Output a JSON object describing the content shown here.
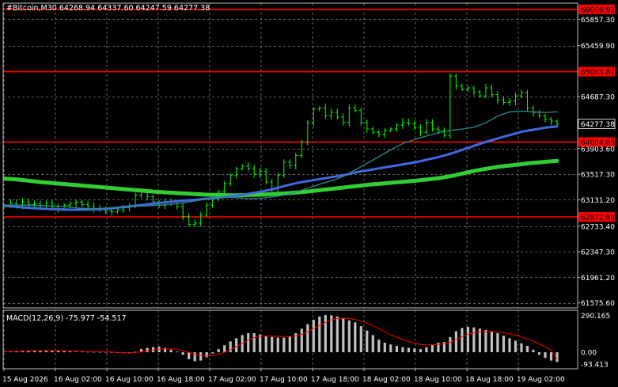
{
  "header": {
    "symbol_info": "#Bitcoin,M30  64268.94 64337.60 64247.59 64277.38"
  },
  "colors": {
    "background": "#000000",
    "grid": "#7f7f7f",
    "candle": "#00ff00",
    "ma_fast": "#2e8b8b",
    "ma_mid": "#4169e1",
    "ma_slow": "#32cd32",
    "level_line": "#ff0000",
    "macd_hist": "#c0c0c0",
    "macd_signal": "#ff0000"
  },
  "price_axis": {
    "ticks": [
      "65857.30",
      "65459.90",
      "64687.30",
      "63903.60",
      "63517.30",
      "63131.20",
      "62733.40",
      "62347.30",
      "61961.20",
      "61575.60"
    ],
    "current_price": "64277.38",
    "levels": [
      "66006.92",
      "65065.82",
      "64004.06",
      "62872.98"
    ]
  },
  "time_axis": {
    "labels": [
      "15 Aug 2026",
      "16 Aug 02:00",
      "16 Aug 10:00",
      "16 Aug 18:00",
      "17 Aug 02:00",
      "17 Aug 10:00",
      "17 Aug 18:00",
      "18 Aug 02:00",
      "18 Aug 10:00",
      "18 Aug 18:00",
      "19 Aug 02:00"
    ]
  },
  "macd": {
    "label": "MACD(12,26,9) -75.977 -54.517",
    "ticks": [
      "290.165",
      "0.00",
      "-93.413"
    ]
  },
  "chart_data": {
    "type": "line",
    "title": "#Bitcoin,M30",
    "ylim": [
      61500,
      66100
    ],
    "x_range": [
      "15 Aug 2026 00:00",
      "19 Aug 2026 07:30"
    ],
    "horizontal_levels": [
      66006.92,
      65065.82,
      64004.06,
      62872.98
    ],
    "series": [
      {
        "style": "candles",
        "values": [
          63040,
          63080,
          63050,
          63100,
          63060,
          63070,
          63040,
          63080,
          63030,
          63000,
          63050,
          63080,
          63100,
          63060,
          63030,
          63000,
          62980,
          62960,
          62950,
          62980,
          63010,
          63040,
          63200,
          63260,
          63180,
          63100,
          63050,
          63090,
          63070,
          63030,
          62880,
          62760,
          62780,
          62900,
          63050,
          63160,
          63250,
          63380,
          63500,
          63600,
          63640,
          63600,
          63520,
          63560,
          63400,
          63300,
          63500,
          63700,
          63650,
          63800,
          64000,
          64300,
          64500,
          64520,
          64400,
          64450,
          64380,
          64300,
          64520,
          64480,
          64300,
          64200,
          64150,
          64120,
          64180,
          64200,
          64260,
          64300,
          64280,
          64220,
          64150,
          64300,
          64200,
          64180,
          64100,
          65000,
          64850,
          64800,
          64820,
          64760,
          64700,
          64820,
          64720,
          64640,
          64600,
          64620,
          64700,
          64750,
          64520,
          64450,
          64400,
          64350,
          64320,
          64277
        ]
      },
      {
        "style": "line",
        "values": [
          63050,
          63055,
          63050,
          63045,
          63040,
          63030,
          63010,
          63000,
          63000,
          63010,
          63020,
          63030,
          63040,
          63050,
          63060,
          63080,
          63110,
          63140,
          63160,
          63170,
          63160,
          63150,
          63160,
          63180,
          63210,
          63260,
          63320,
          63380,
          63430,
          63500,
          63600,
          63700,
          63800,
          63900,
          63990,
          64050,
          64100,
          64150,
          64180,
          64200,
          64230,
          64300,
          64400,
          64460,
          64470,
          64460,
          64450,
          64460
        ]
      },
      {
        "style": "line",
        "values": [
          63040,
          63025,
          63010,
          63000,
          62990,
          62985,
          62980,
          62985,
          62990,
          63000,
          63020,
          63040,
          63060,
          63080,
          63100,
          63115,
          63130,
          63145,
          63160,
          63180,
          63200,
          63230,
          63260,
          63300,
          63350,
          63390,
          63420,
          63450,
          63480,
          63510,
          63550,
          63580,
          63610,
          63640,
          63670,
          63700,
          63740,
          63780,
          63830,
          63890,
          63950,
          64010,
          64060,
          64110,
          64160,
          64190,
          64220,
          64240
        ]
      },
      {
        "style": "line",
        "values": [
          63450,
          63440,
          63420,
          63400,
          63385,
          63370,
          63355,
          63340,
          63325,
          63310,
          63295,
          63280,
          63265,
          63250,
          63240,
          63230,
          63220,
          63210,
          63205,
          63200,
          63200,
          63205,
          63210,
          63220,
          63230,
          63245,
          63260,
          63280,
          63300,
          63320,
          63340,
          63360,
          63375,
          63390,
          63405,
          63420,
          63440,
          63460,
          63490,
          63530,
          63570,
          63600,
          63630,
          63650,
          63670,
          63690,
          63705,
          63720
        ]
      }
    ],
    "macd": {
      "ylim": [
        -130,
        330
      ],
      "histogram": [
        5,
        8,
        10,
        12,
        14,
        15,
        15,
        14,
        12,
        10,
        8,
        6,
        4,
        3,
        2,
        1,
        0,
        -2,
        -4,
        -5,
        -6,
        -8,
        5,
        25,
        35,
        40,
        45,
        35,
        20,
        5,
        -20,
        -55,
        -70,
        -65,
        -40,
        -10,
        25,
        55,
        85,
        110,
        135,
        150,
        150,
        140,
        130,
        120,
        115,
        115,
        125,
        150,
        185,
        220,
        255,
        280,
        292,
        290,
        280,
        265,
        250,
        235,
        205,
        170,
        135,
        100,
        75,
        60,
        50,
        40,
        35,
        30,
        25,
        40,
        60,
        75,
        80,
        120,
        165,
        190,
        200,
        195,
        185,
        175,
        165,
        150,
        130,
        110,
        90,
        70,
        50,
        20,
        -20,
        -45,
        -65,
        -76
      ],
      "signal": [
        5,
        6,
        7,
        8,
        10,
        11,
        12,
        13,
        13,
        12,
        11,
        10,
        9,
        8,
        6,
        5,
        4,
        3,
        1,
        -1,
        -3,
        -4,
        -2,
        4,
        10,
        18,
        25,
        28,
        27,
        23,
        14,
        0,
        -15,
        -25,
        -30,
        -25,
        -15,
        0,
        20,
        45,
        70,
        95,
        115,
        125,
        128,
        127,
        125,
        123,
        123,
        128,
        140,
        160,
        185,
        210,
        235,
        255,
        265,
        268,
        265,
        258,
        245,
        228,
        208,
        185,
        160,
        138,
        118,
        100,
        85,
        72,
        62,
        57,
        58,
        62,
        66,
        78,
        98,
        120,
        140,
        152,
        160,
        163,
        163,
        160,
        154,
        145,
        134,
        120,
        105,
        88,
        66,
        43,
        18,
        -55
      ]
    }
  }
}
